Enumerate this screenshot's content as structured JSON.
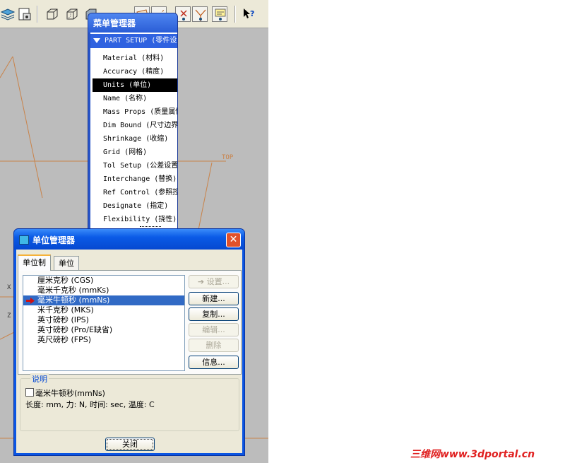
{
  "toolbar": {
    "icons": [
      "layers-icon",
      "saved-view-icon",
      "wireframe-box-icon",
      "hidden-line-box-icon",
      "shaded-box-icon",
      "datum-plane-icon",
      "datum-axis-icon",
      "point-icon",
      "csys-icon",
      "annotation-icon",
      "whats-this-icon"
    ]
  },
  "graphics": {
    "top_label": "TOP",
    "x_label": "X",
    "z_label": "Z"
  },
  "menu_manager": {
    "title": "菜单管理器",
    "header": "PART SETUP (零件设置)",
    "items": [
      {
        "label": "Material (材料)"
      },
      {
        "label": "Accuracy (精度)"
      },
      {
        "label": "Units (单位)"
      },
      {
        "label": "Name (名称)"
      },
      {
        "label": "Mass Props (质量属性)"
      },
      {
        "label": "Dim Bound (尺寸边界)"
      },
      {
        "label": "Shrinkage (收缩)"
      },
      {
        "label": "Grid (网格)"
      },
      {
        "label": "Tol Setup (公差设置)"
      },
      {
        "label": "Interchange (替换)"
      },
      {
        "label": "Ref Control (参照控制)"
      },
      {
        "label": "Designate (指定)"
      },
      {
        "label": "Flexibility (挠性)"
      }
    ],
    "selected_index": 2
  },
  "dialog": {
    "title": "单位管理器",
    "close_glyph": "✕",
    "tabs": [
      {
        "label": "单位制",
        "active": true
      },
      {
        "label": "单位",
        "active": false
      }
    ],
    "unit_systems": [
      {
        "label": "厘米克秒 (CGS)"
      },
      {
        "label": "毫米千克秒 (mmKs)"
      },
      {
        "label": "毫米牛顿秒 (mmNs)"
      },
      {
        "label": "米千克秒 (MKS)"
      },
      {
        "label": "英寸磅秒 (IPS)"
      },
      {
        "label": "英寸磅秒 (Pro/E缺省)"
      },
      {
        "label": "英尺磅秒 (FPS)"
      }
    ],
    "selected_index": 2,
    "buttons": {
      "set": "➔ 设置...",
      "new": "新建...",
      "copy": "复制...",
      "edit": "编辑...",
      "delete": "删除",
      "info": "信息..."
    },
    "description": {
      "legend": "说明",
      "name": "毫米牛顿秒(mmNs)",
      "details": "长度: mm, 力: N, 时间: sec, 温度: C"
    },
    "close_label": "关闭"
  },
  "watermark": {
    "site_cn": "三维网",
    "url": "www.3dportal.cn"
  },
  "colors": {
    "xp_blue": "#0b55e2",
    "selection": "#316ac5",
    "datum_orange": "#c9834a",
    "graphics_bg": "#bcbcbc"
  }
}
